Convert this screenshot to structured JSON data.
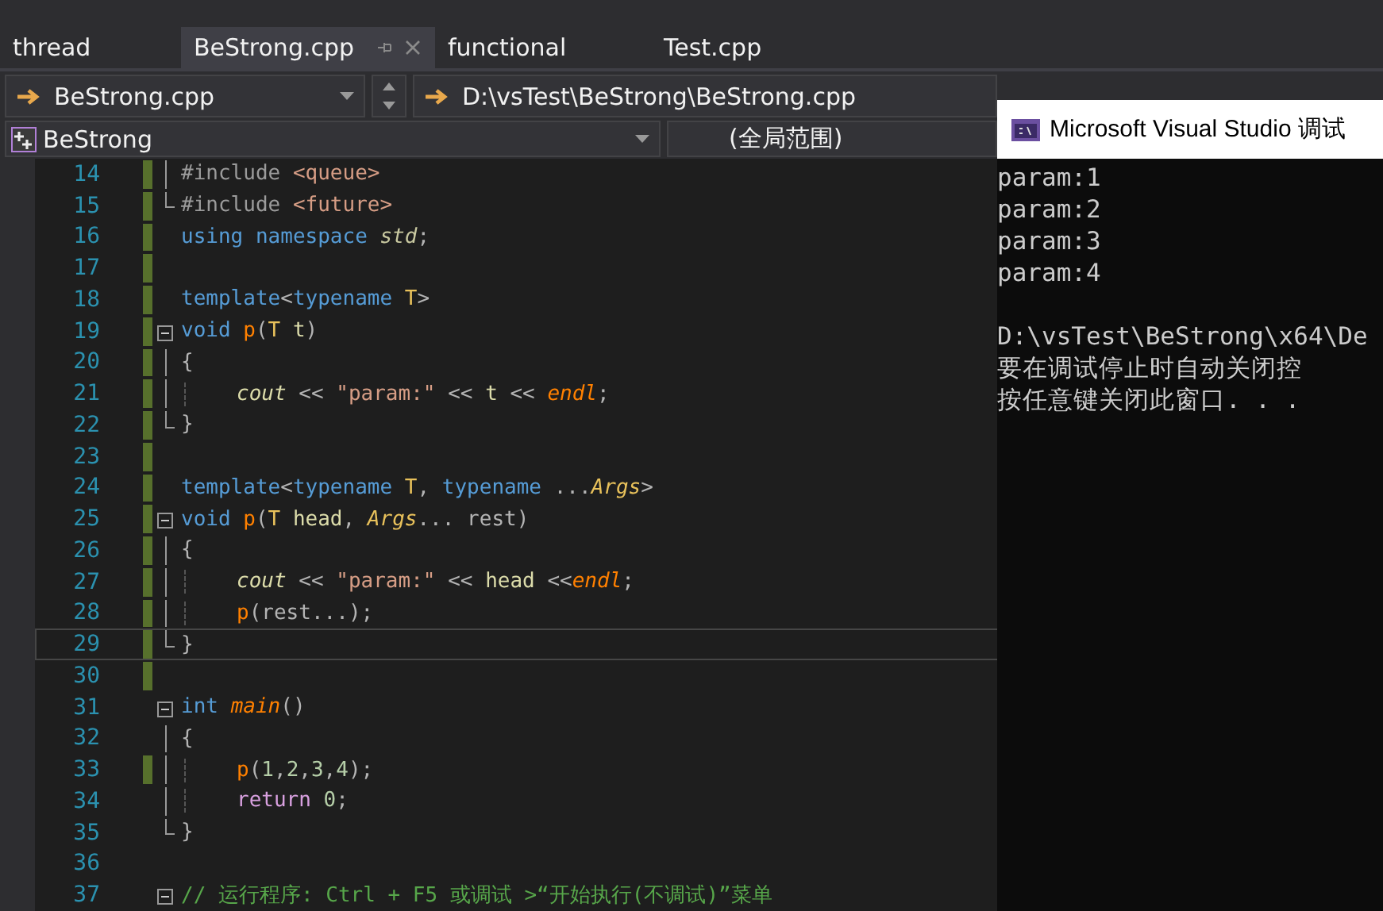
{
  "tabs": [
    {
      "label": "thread",
      "selected": false
    },
    {
      "label": "BeStrong.cpp",
      "selected": true
    },
    {
      "label": "functional",
      "selected": false
    },
    {
      "label": "Test.cpp",
      "selected": false
    }
  ],
  "navigation": {
    "file_dropdown": "BeStrong.cpp",
    "path": "D:\\vsTest\\BeStrong\\BeStrong.cpp",
    "class_dropdown": "BeStrong",
    "scope_dropdown": "(全局范围)"
  },
  "editor": {
    "lines": [
      {
        "number": "14",
        "kind": "fold-line",
        "changed": true,
        "current": false,
        "indented": false,
        "tokens": [
          {
            "kind": "directive",
            "text": "#include "
          },
          {
            "kind": "header",
            "text": "<queue>"
          }
        ]
      },
      {
        "number": "15",
        "kind": "fold-end",
        "changed": true,
        "current": false,
        "indented": false,
        "tokens": [
          {
            "kind": "directive",
            "text": "#include "
          },
          {
            "kind": "header",
            "text": "<future>"
          }
        ]
      },
      {
        "number": "16",
        "kind": "plain",
        "changed": true,
        "current": false,
        "indented": false,
        "tokens": [
          {
            "kind": "keyword",
            "text": "using namespace "
          },
          {
            "kind": "namespace",
            "text": "std"
          },
          {
            "kind": "plain",
            "text": ";"
          }
        ]
      },
      {
        "number": "17",
        "kind": "plain",
        "changed": true,
        "current": false
      },
      {
        "number": "18",
        "kind": "plain",
        "changed": true,
        "current": false,
        "indented": false,
        "tokens": [
          {
            "kind": "keyword",
            "text": "template"
          },
          {
            "kind": "plain",
            "text": "<"
          },
          {
            "kind": "keyword",
            "text": "typename "
          },
          {
            "kind": "type",
            "text": "T"
          },
          {
            "kind": "plain",
            "text": ">"
          }
        ]
      },
      {
        "number": "19",
        "kind": "fold-start",
        "changed": true,
        "current": false,
        "indented": false,
        "tokens": [
          {
            "kind": "keyword",
            "text": "void "
          },
          {
            "kind": "function",
            "text": "p"
          },
          {
            "kind": "plain",
            "text": "("
          },
          {
            "kind": "type",
            "text": "T "
          },
          {
            "kind": "param",
            "text": "t"
          },
          {
            "kind": "plain",
            "text": ")"
          }
        ]
      },
      {
        "number": "20",
        "kind": "fold-line",
        "changed": true,
        "current": false,
        "indented": false,
        "tokens": [
          {
            "kind": "plain",
            "text": "{"
          }
        ]
      },
      {
        "number": "21",
        "kind": "fold-line",
        "changed": true,
        "current": false,
        "indented": true,
        "tokens": [
          {
            "kind": "global",
            "text": "cout"
          },
          {
            "kind": "plain",
            "text": " << "
          },
          {
            "kind": "string",
            "text": "\"param:\""
          },
          {
            "kind": "plain",
            "text": " << "
          },
          {
            "kind": "param",
            "text": "t"
          },
          {
            "kind": "plain",
            "text": " << "
          },
          {
            "kind": "global-function",
            "text": "endl"
          },
          {
            "kind": "plain",
            "text": ";"
          }
        ]
      },
      {
        "number": "22",
        "kind": "fold-end",
        "changed": true,
        "current": false,
        "indented": false,
        "tokens": [
          {
            "kind": "plain",
            "text": "}"
          }
        ]
      },
      {
        "number": "23",
        "kind": "plain",
        "changed": true,
        "current": false
      },
      {
        "number": "24",
        "kind": "plain",
        "changed": true,
        "current": false,
        "indented": false,
        "tokens": [
          {
            "kind": "keyword",
            "text": "template"
          },
          {
            "kind": "plain",
            "text": "<"
          },
          {
            "kind": "keyword",
            "text": "typename "
          },
          {
            "kind": "type",
            "text": "T"
          },
          {
            "kind": "plain",
            "text": ", "
          },
          {
            "kind": "keyword",
            "text": "typename "
          },
          {
            "kind": "plain",
            "text": "..."
          },
          {
            "kind": "pack",
            "text": "Args"
          },
          {
            "kind": "plain",
            "text": ">"
          }
        ]
      },
      {
        "number": "25",
        "kind": "fold-start",
        "changed": true,
        "current": false,
        "indented": false,
        "tokens": [
          {
            "kind": "keyword",
            "text": "void "
          },
          {
            "kind": "function",
            "text": "p"
          },
          {
            "kind": "plain",
            "text": "("
          },
          {
            "kind": "type",
            "text": "T "
          },
          {
            "kind": "param",
            "text": "head"
          },
          {
            "kind": "plain",
            "text": ", "
          },
          {
            "kind": "pack",
            "text": "Args"
          },
          {
            "kind": "plain",
            "text": "... rest)"
          }
        ]
      },
      {
        "number": "26",
        "kind": "fold-line",
        "changed": true,
        "current": false,
        "indented": false,
        "tokens": [
          {
            "kind": "plain",
            "text": "{"
          }
        ]
      },
      {
        "number": "27",
        "kind": "fold-line",
        "changed": true,
        "current": false,
        "indented": true,
        "tokens": [
          {
            "kind": "global",
            "text": "cout"
          },
          {
            "kind": "plain",
            "text": " << "
          },
          {
            "kind": "string",
            "text": "\"param:\""
          },
          {
            "kind": "plain",
            "text": " << "
          },
          {
            "kind": "param",
            "text": "head"
          },
          {
            "kind": "plain",
            "text": " <<"
          },
          {
            "kind": "global-function",
            "text": "endl"
          },
          {
            "kind": "plain",
            "text": ";"
          }
        ]
      },
      {
        "number": "28",
        "kind": "fold-line",
        "changed": true,
        "current": false,
        "indented": true,
        "tokens": [
          {
            "kind": "function",
            "text": "p"
          },
          {
            "kind": "plain",
            "text": "(rest...);"
          }
        ]
      },
      {
        "number": "29",
        "kind": "fold-end",
        "changed": true,
        "current": true,
        "indented": false,
        "tokens": [
          {
            "kind": "plain",
            "text": "}"
          }
        ]
      },
      {
        "number": "30",
        "kind": "plain",
        "changed": true,
        "current": false
      },
      {
        "number": "31",
        "kind": "fold-start",
        "changed": false,
        "current": false,
        "indented": false,
        "tokens": [
          {
            "kind": "keyword",
            "text": "int "
          },
          {
            "kind": "global-function",
            "text": "main"
          },
          {
            "kind": "plain",
            "text": "()"
          }
        ]
      },
      {
        "number": "32",
        "kind": "fold-line",
        "changed": false,
        "current": false,
        "indented": false,
        "tokens": [
          {
            "kind": "plain",
            "text": "{"
          }
        ]
      },
      {
        "number": "33",
        "kind": "fold-line",
        "changed": true,
        "current": false,
        "indented": true,
        "tokens": [
          {
            "kind": "function",
            "text": "p"
          },
          {
            "kind": "plain",
            "text": "("
          },
          {
            "kind": "number",
            "text": "1"
          },
          {
            "kind": "plain",
            "text": ","
          },
          {
            "kind": "number",
            "text": "2"
          },
          {
            "kind": "plain",
            "text": ","
          },
          {
            "kind": "number",
            "text": "3"
          },
          {
            "kind": "plain",
            "text": ","
          },
          {
            "kind": "number",
            "text": "4"
          },
          {
            "kind": "plain",
            "text": ");"
          }
        ]
      },
      {
        "number": "34",
        "kind": "fold-line",
        "changed": false,
        "current": false,
        "indented": true,
        "tokens": [
          {
            "kind": "control",
            "text": "return "
          },
          {
            "kind": "number",
            "text": "0"
          },
          {
            "kind": "plain",
            "text": ";"
          }
        ]
      },
      {
        "number": "35",
        "kind": "fold-end",
        "changed": false,
        "current": false,
        "indented": false,
        "tokens": [
          {
            "kind": "plain",
            "text": "}"
          }
        ]
      },
      {
        "number": "36",
        "kind": "plain",
        "changed": false,
        "current": false
      },
      {
        "number": "37",
        "kind": "fold-start",
        "changed": false,
        "current": false,
        "indented": false,
        "tokens": [
          {
            "kind": "comment",
            "text": "// 运行程序: Ctrl + F5 或调试 >“开始执行(不调试)”菜单"
          }
        ]
      }
    ]
  },
  "console": {
    "title": "Microsoft Visual Studio 调试",
    "output": [
      "param:1",
      "param:2",
      "param:3",
      "param:4"
    ],
    "messages": [
      "D:\\vsTest\\BeStrong\\x64\\De",
      "要在调试停止时自动关闭控",
      "按任意键关闭此窗口. . ."
    ]
  }
}
